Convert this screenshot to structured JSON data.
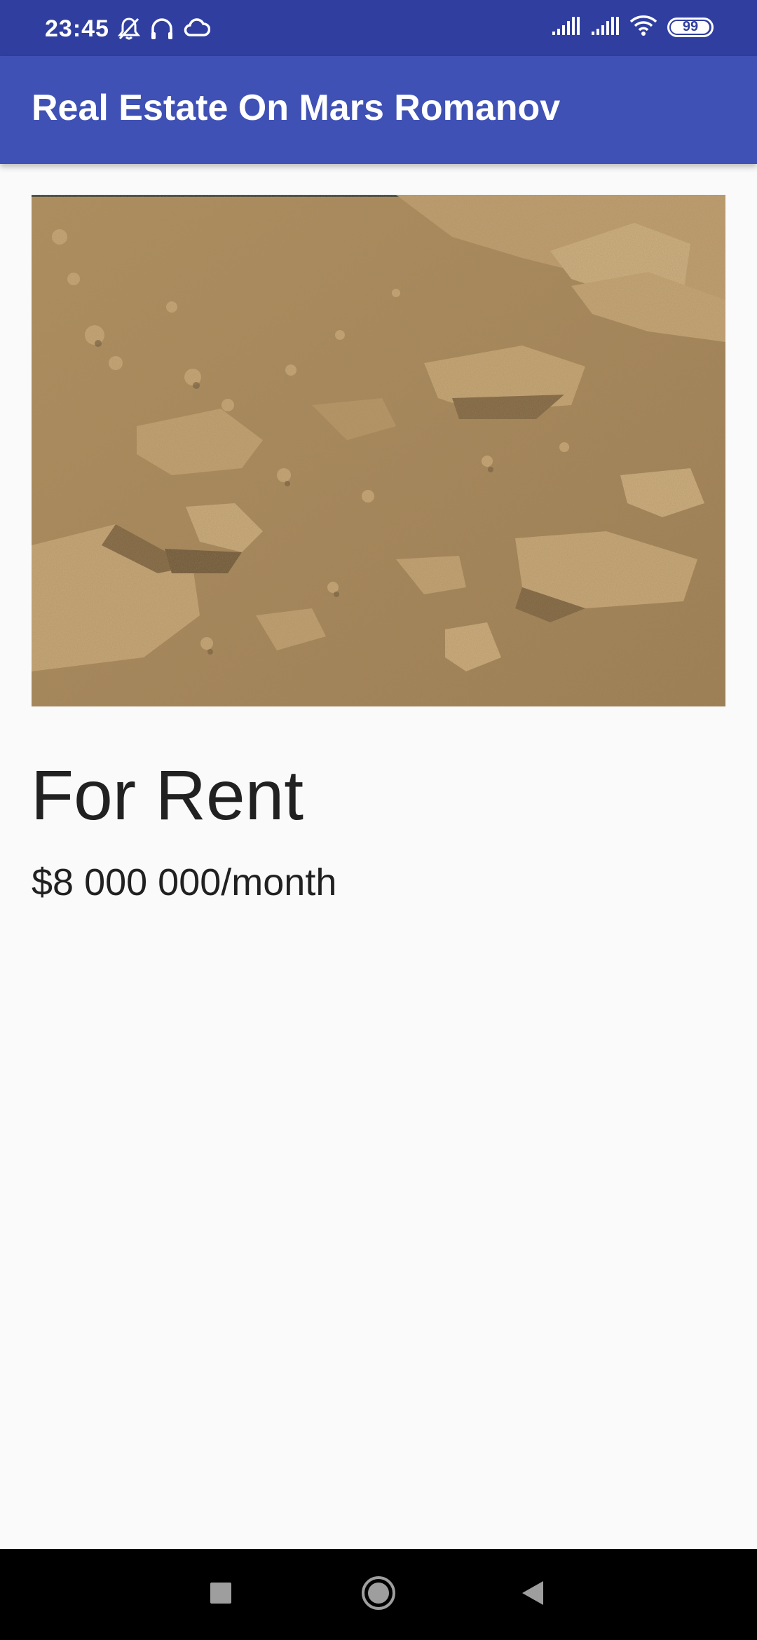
{
  "status_bar": {
    "time": "23:45",
    "battery": "99",
    "battery_level": 0.99
  },
  "app_bar": {
    "title": "Real Estate On Mars Romanov"
  },
  "listing": {
    "type": "For Rent",
    "price": "$8 000 000/month"
  },
  "icons": {
    "status_left": [
      "bell-off-icon",
      "headphones-icon",
      "cloud-icon"
    ],
    "status_right": [
      "signal-icon",
      "signal-icon",
      "wifi-icon",
      "battery-icon"
    ],
    "nav": [
      "recents-square-icon",
      "home-circle-icon",
      "back-triangle-icon"
    ]
  },
  "colors": {
    "status_bar": "#303f9f",
    "app_bar": "#3f51b5",
    "background": "#fafafa",
    "text": "#212121",
    "nav_bar": "#000000"
  }
}
